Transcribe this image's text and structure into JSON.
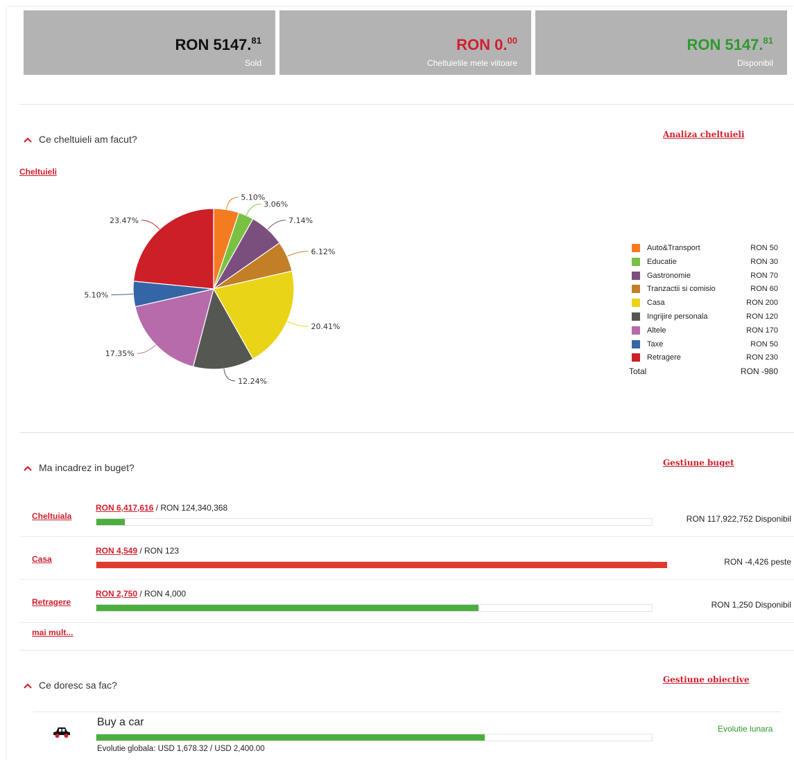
{
  "summary": {
    "sold": {
      "currency": "RON",
      "int": "5147.",
      "dec": "81",
      "label": "Sold",
      "color": "#111111"
    },
    "viitoare": {
      "currency": "RON",
      "int": "0.",
      "dec": "00",
      "label": "Cheltuielile mele viitoare",
      "color": "#d0202e"
    },
    "disponibil": {
      "currency": "RON",
      "int": "5147.",
      "dec": "81",
      "label": "Disponibil",
      "color": "#2e9a2e"
    }
  },
  "expenses": {
    "title": "Ce cheltuieli am facut?",
    "analysis_link": "Analiza cheltuieli",
    "chart_link": "Cheltuieli"
  },
  "chart_data": {
    "type": "pie",
    "categories": [
      "Auto&Transport",
      "Educatie",
      "Gastronomie",
      "Tranzactii si comisio",
      "Casa",
      "Ingrijire personala",
      "Altele",
      "Taxe",
      "Retragere"
    ],
    "values": [
      50,
      30,
      70,
      60,
      200,
      120,
      170,
      50,
      230
    ],
    "percent_labels": [
      "5.10%",
      "3.06%",
      "7.14%",
      "6.12%",
      "20.41%",
      "12.24%",
      "17.35%",
      "5.10%",
      "23.47%"
    ],
    "value_labels": [
      "RON 50",
      "RON 30",
      "RON 70",
      "RON 60",
      "RON 200",
      "RON 120",
      "RON 170",
      "RON 50",
      "RON 230"
    ],
    "colors": [
      "#f47b20",
      "#7ac143",
      "#7a4f7e",
      "#c27f27",
      "#e9d418",
      "#555753",
      "#b76bab",
      "#3466a5",
      "#cc1f27"
    ],
    "total_label": "Total",
    "total_value": "RON -980",
    "legend_position": "right"
  },
  "budget": {
    "title": "Ma incadrez in buget?",
    "manage_link": "Gestiune buget",
    "rows": [
      {
        "name": "Cheltuiala",
        "spent": "RON 6,417,616",
        "limit": " / RON 124,340,368",
        "right": "RON 117,922,752 Disponibil",
        "progress": 0.0516,
        "color": "#4cae3f"
      },
      {
        "name": "Casa",
        "spent": "RON 4,549",
        "limit": " / RON 123",
        "right": "RON -4,426 peste",
        "progress": 1.0,
        "color": "#e03a2f"
      },
      {
        "name": "Retragere",
        "spent": "RON 2,750",
        "limit": " / RON 4,000",
        "right": "RON 1,250 Disponibil",
        "progress": 0.6875,
        "color": "#4cae3f"
      }
    ],
    "more_link": "mai mult..."
  },
  "goals": {
    "title": "Ce doresc sa fac?",
    "manage_link": "Gestiune obiective",
    "items": [
      {
        "name": "Buy a car",
        "icon": "car-icon",
        "progress": 0.6993,
        "global": "Evolutie globala: USD 1,678.32 / USD 2,400.00",
        "monthly_link": "Evolutie lunara"
      }
    ]
  }
}
